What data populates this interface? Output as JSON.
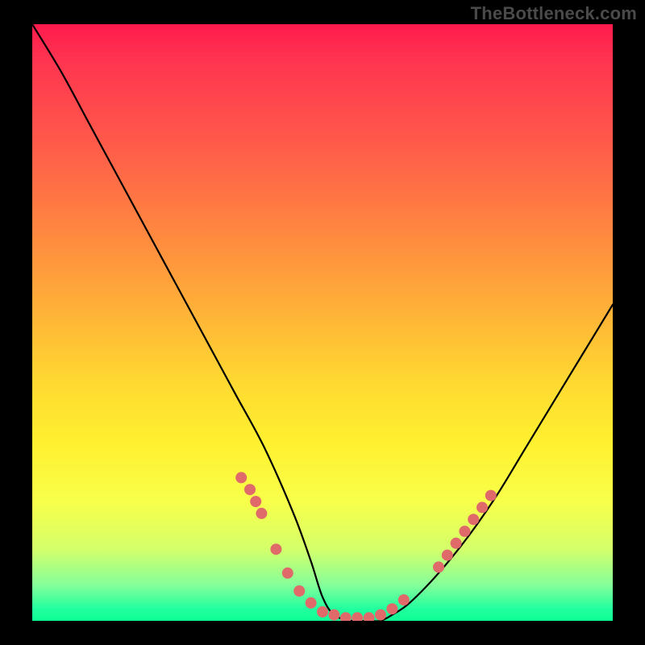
{
  "watermark": "TheBottleneck.com",
  "chart_data": {
    "type": "line",
    "title": "",
    "xlabel": "",
    "ylabel": "",
    "xlim": [
      0,
      100
    ],
    "ylim": [
      0,
      100
    ],
    "series": [
      {
        "name": "bottleneck-curve",
        "x": [
          0,
          5,
          10,
          15,
          20,
          25,
          30,
          35,
          40,
          45,
          48,
          50,
          52,
          55,
          58,
          60,
          62,
          65,
          70,
          75,
          80,
          85,
          90,
          95,
          100
        ],
        "y": [
          100,
          92,
          83,
          74,
          65,
          56,
          47,
          38,
          29,
          18,
          10,
          4,
          1,
          0,
          0,
          0,
          1,
          3,
          8,
          14,
          21,
          29,
          37,
          45,
          53
        ]
      }
    ],
    "markers": {
      "name": "highlight-dots",
      "color": "#e06a6a",
      "x": [
        36,
        37.5,
        38.5,
        39.5,
        42,
        44,
        46,
        48,
        50,
        52,
        54,
        56,
        58,
        60,
        62,
        64,
        70,
        71.5,
        73,
        74.5,
        76,
        77.5,
        79
      ],
      "y": [
        24,
        22,
        20,
        18,
        12,
        8,
        5,
        3,
        1.5,
        1,
        0.5,
        0.5,
        0.5,
        1,
        2,
        3.5,
        9,
        11,
        13,
        15,
        17,
        19,
        21
      ]
    },
    "gradient_stops": [
      {
        "pos": 0.0,
        "color": "#ff1a4d"
      },
      {
        "pos": 0.2,
        "color": "#ff5a4a"
      },
      {
        "pos": 0.5,
        "color": "#ffb836"
      },
      {
        "pos": 0.7,
        "color": "#fff02f"
      },
      {
        "pos": 0.88,
        "color": "#d4ff6a"
      },
      {
        "pos": 1.0,
        "color": "#0cff94"
      }
    ]
  }
}
